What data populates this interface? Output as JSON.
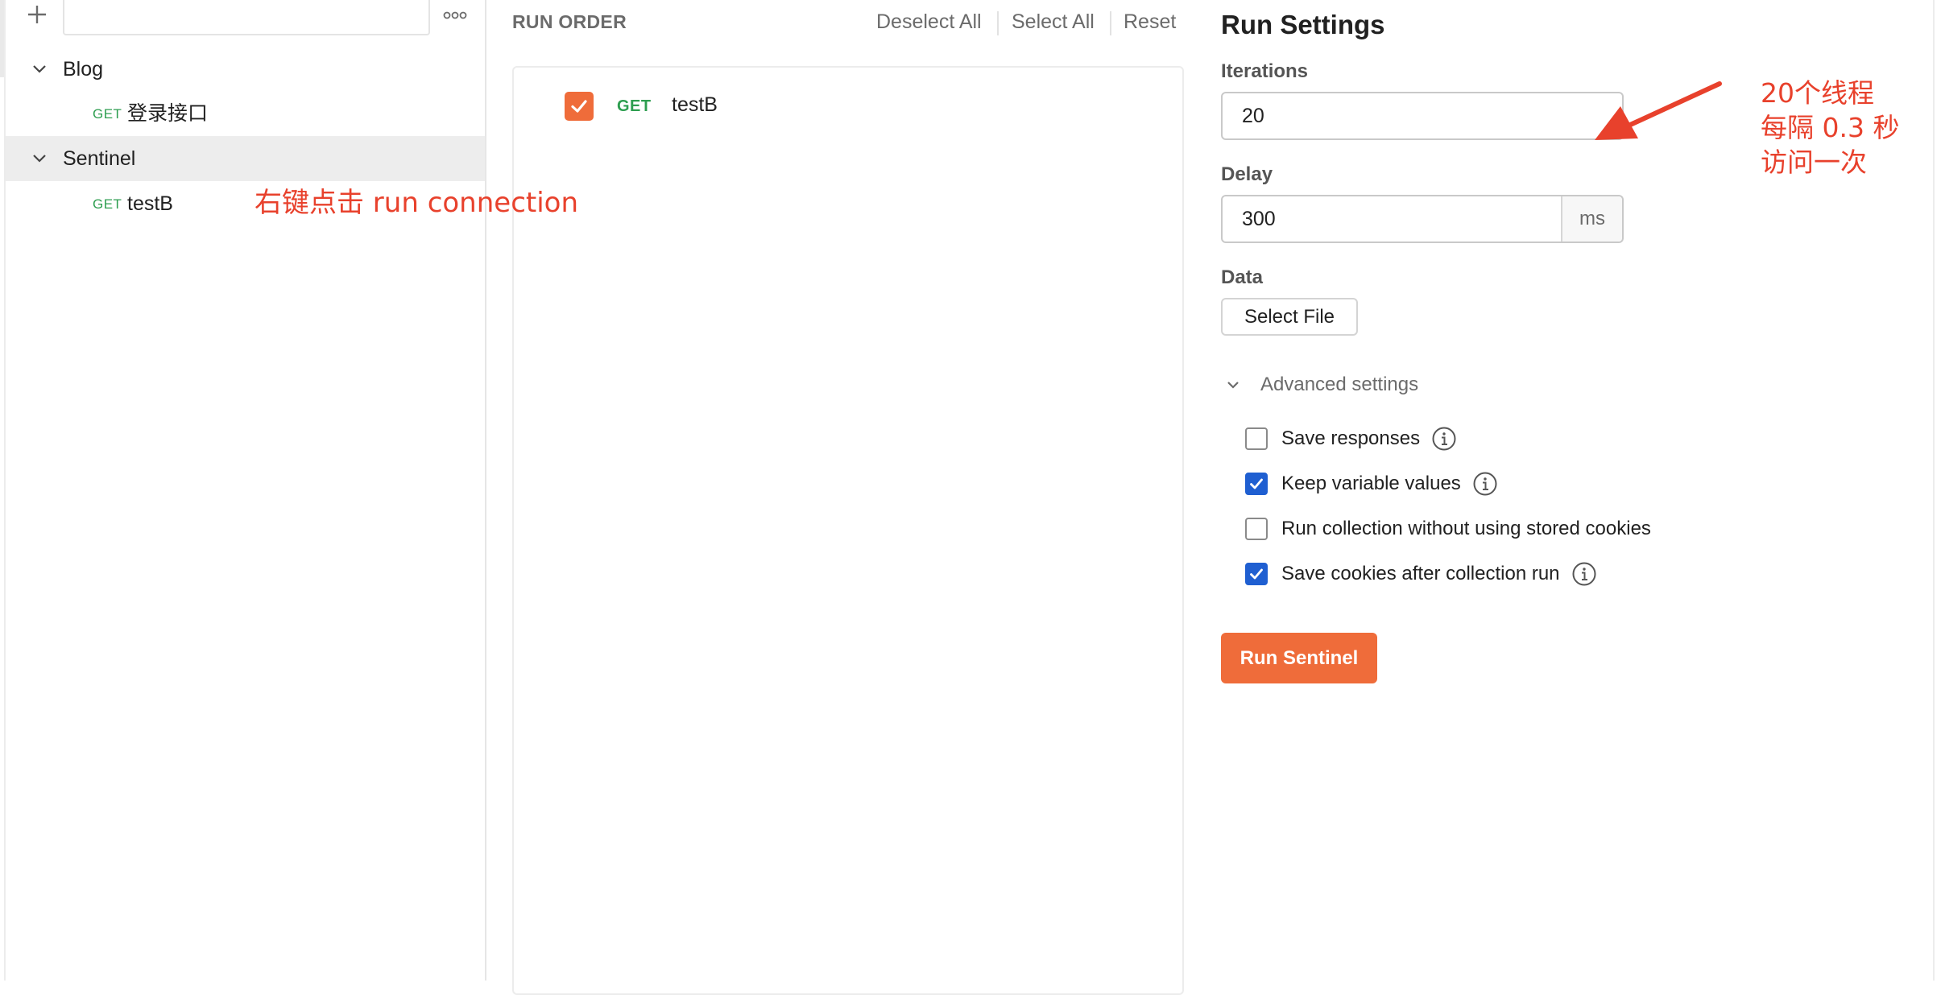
{
  "sidebar": {
    "add_icon": "plus-icon",
    "filter_icon": "filter-lines-icon",
    "more_icon": "more-horizontal-icon",
    "filter_placeholder": "",
    "tree": [
      {
        "type": "folder",
        "label": "Blog"
      },
      {
        "type": "request",
        "method": "GET",
        "label": "登录接口"
      },
      {
        "type": "folder",
        "label": "Sentinel"
      },
      {
        "type": "request",
        "method": "GET",
        "label": "testB"
      }
    ]
  },
  "run_order": {
    "title": "RUN ORDER",
    "actions": {
      "deselect_all": "Deselect All",
      "select_all": "Select All",
      "reset": "Reset"
    },
    "items": [
      {
        "method": "GET",
        "name": "testB",
        "checked": true
      }
    ]
  },
  "run_settings": {
    "title": "Run Settings",
    "iterations_label": "Iterations",
    "iterations_value": "20",
    "delay_label": "Delay",
    "delay_value": "300",
    "delay_unit": "ms",
    "data_label": "Data",
    "select_file": "Select File",
    "advanced_label": "Advanced settings",
    "options": [
      {
        "label": "Save responses",
        "checked": false,
        "info": true
      },
      {
        "label": "Keep variable values",
        "checked": true,
        "info": true
      },
      {
        "label": "Run collection without using stored cookies",
        "checked": false,
        "info": false
      },
      {
        "label": "Save cookies after collection run",
        "checked": true,
        "info": true
      }
    ],
    "run_button": "Run Sentinel"
  },
  "annotations": {
    "left_note": "右键点击 run connection",
    "right_note_lines": [
      "20个线程",
      "每隔 0.3 秒",
      "访问一次"
    ]
  },
  "colors": {
    "accent": "#ef6c3a",
    "checkbox_blue": "#1f5fd1",
    "get_green": "#2e9e50",
    "annotation_red": "#e8412c"
  }
}
